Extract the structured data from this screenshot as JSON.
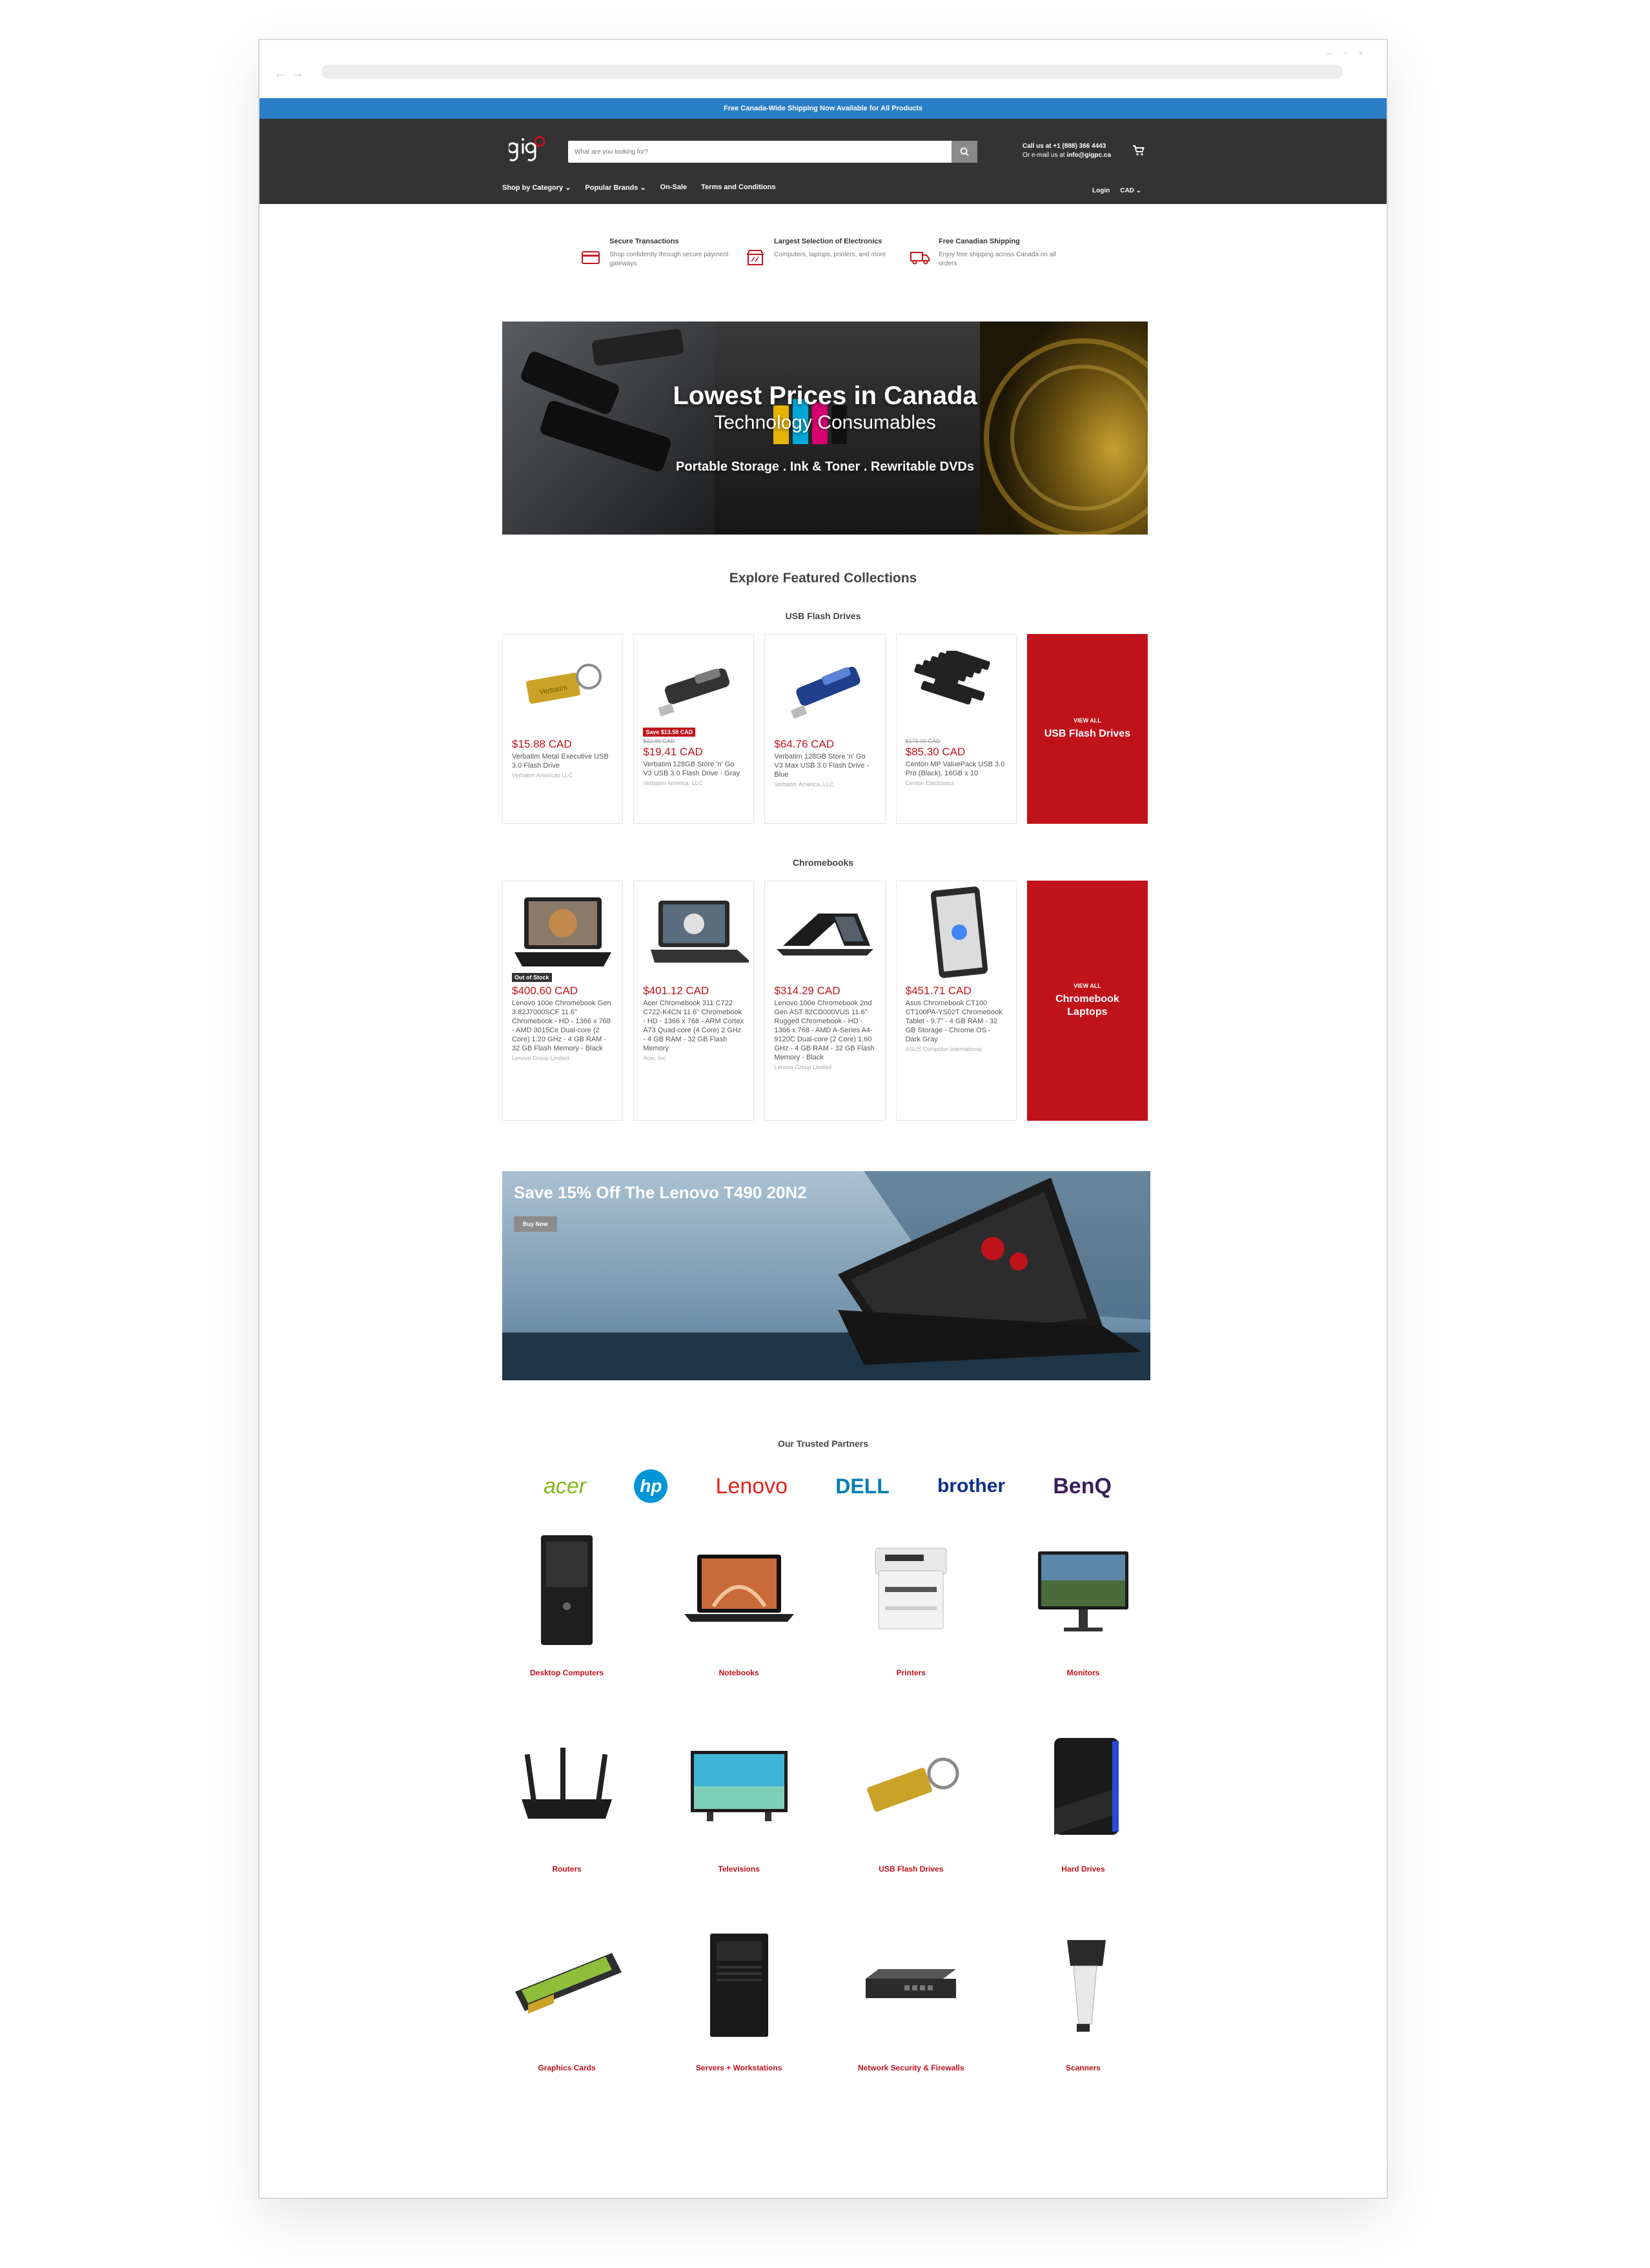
{
  "announcement": "Free Canada-Wide Shipping Now Available for All Products",
  "search": {
    "placeholder": "What are you looking for?"
  },
  "contact": {
    "call_label": "Call us at",
    "phone": "+1 (888) 366 4443",
    "email_label": "Or e-mail us at",
    "email": "info@gigpc.ca"
  },
  "nav": {
    "items": [
      "Shop by Category",
      "Popular Brands",
      "On-Sale",
      "Terms and Conditions"
    ],
    "login": "Login",
    "currency": "CAD"
  },
  "features": [
    {
      "title": "Secure Transactions",
      "desc": "Shop confidently through secure payment gateways",
      "icon": "credit-card-icon"
    },
    {
      "title": "Largest Selection of Electronics",
      "desc": "Computers, laptops, printers, and more",
      "icon": "store-icon"
    },
    {
      "title": "Free Canadian Shipping",
      "desc": "Enjoy free shipping across Canada on all orders",
      "icon": "truck-icon"
    }
  ],
  "hero": {
    "line1": "Lowest Prices in Canada",
    "line2": "Technology Consumables",
    "line3": "Portable Storage . Ink & Toner . Rewritable DVDs"
  },
  "featured_title": "Explore Featured Collections",
  "collections": [
    {
      "title": "USB Flash Drives",
      "view_all_small": "VIEW ALL",
      "view_all": "USB Flash Drives",
      "products": [
        {
          "price": "$15.88 CAD",
          "old": "",
          "badge": "",
          "name": "Verbatim Metal Executive USB 3.0 Flash Drive",
          "vendor": "Verbatim Americas LLC"
        },
        {
          "price": "$19.41 CAD",
          "old": "$32.99 CAD",
          "badge": "Save $13.58 CAD",
          "name": "Verbatim 128GB Store 'n' Go V3 USB 3.0 Flash Drive - Gray",
          "vendor": "Verbatim America, LLC"
        },
        {
          "price": "$64.76 CAD",
          "old": "",
          "badge": "",
          "name": "Verbatim 128GB Store 'n' Go V3 Max USB 3.0 Flash Drive - Blue",
          "vendor": "Verbatim America, LLC"
        },
        {
          "price": "$85.30 CAD",
          "old": "$175.00 CAD",
          "badge": "",
          "name": "Centon MP ValuePack USB 3.0 Pro (Black), 16GB x 10",
          "vendor": "Centon Electronics"
        }
      ]
    },
    {
      "title": "Chromebooks",
      "view_all_small": "VIEW ALL",
      "view_all": "Chromebook Laptops",
      "products": [
        {
          "price": "$400.60 CAD",
          "old": "",
          "badge": "Out of Stock",
          "name": "Lenovo 100e Chromebook Gen 3 82J7000SCF 11.6\" Chromebook - HD - 1366 x 768 - AMD 3015Ce Dual-core (2 Core) 1.20 GHz - 4 GB RAM - 32 GB Flash Memory - Black",
          "vendor": "Lenovo Group Limited"
        },
        {
          "price": "$401.12 CAD",
          "old": "",
          "badge": "",
          "name": "Acer Chromebook 311 C722 C722-K4CN 11.6\" Chromebook - HD - 1366 x 768 - ARM Cortex A73 Quad-core (4 Core) 2 GHz - 4 GB RAM - 32 GB Flash Memory",
          "vendor": "Acer, Inc"
        },
        {
          "price": "$314.29 CAD",
          "old": "",
          "badge": "",
          "name": "Lenovo 100e Chromebook 2nd Gen AST 82CD000VUS 11.6\" Rugged Chromebook - HD - 1366 x 768 - AMD A-Series A4-9120C Dual-core (2 Core) 1.60 GHz - 4 GB RAM - 32 GB Flash Memory - Black",
          "vendor": "Lenovo Group Limited"
        },
        {
          "price": "$451.71 CAD",
          "old": "",
          "badge": "",
          "name": "Asus Chromebook CT100 CT100PA-YS02T Chromebook Tablet - 9.7\" - 4 GB RAM - 32 GB Storage - Chrome OS - Dark Gray",
          "vendor": "ASUS Computer International"
        }
      ]
    }
  ],
  "promo": {
    "title": "Save 15% Off The Lenovo T490 20N2",
    "button": "Buy Now"
  },
  "partners_title": "Our Trusted Partners",
  "brands": [
    {
      "name": "acer",
      "color": "#83b81a"
    },
    {
      "name": "hp",
      "color": "#0096d6"
    },
    {
      "name": "Lenovo",
      "color": "#e2231a"
    },
    {
      "name": "DELL",
      "color": "#007db8"
    },
    {
      "name": "brother",
      "color": "#0d2d8c"
    },
    {
      "name": "BenQ",
      "color": "#3a1f5d"
    }
  ],
  "categories": [
    [
      "Desktop Computers",
      "Notebooks",
      "Printers",
      "Monitors"
    ],
    [
      "Routers",
      "Televisions",
      "USB Flash Drives",
      "Hard Drives"
    ],
    [
      "Graphics Cards",
      "Servers + Workstations",
      "Network Security & Firewalls",
      "Scanners"
    ]
  ],
  "colors": {
    "brand_red": "#c0121b",
    "header": "#333333",
    "promo_bar": "#2a7ec6"
  }
}
